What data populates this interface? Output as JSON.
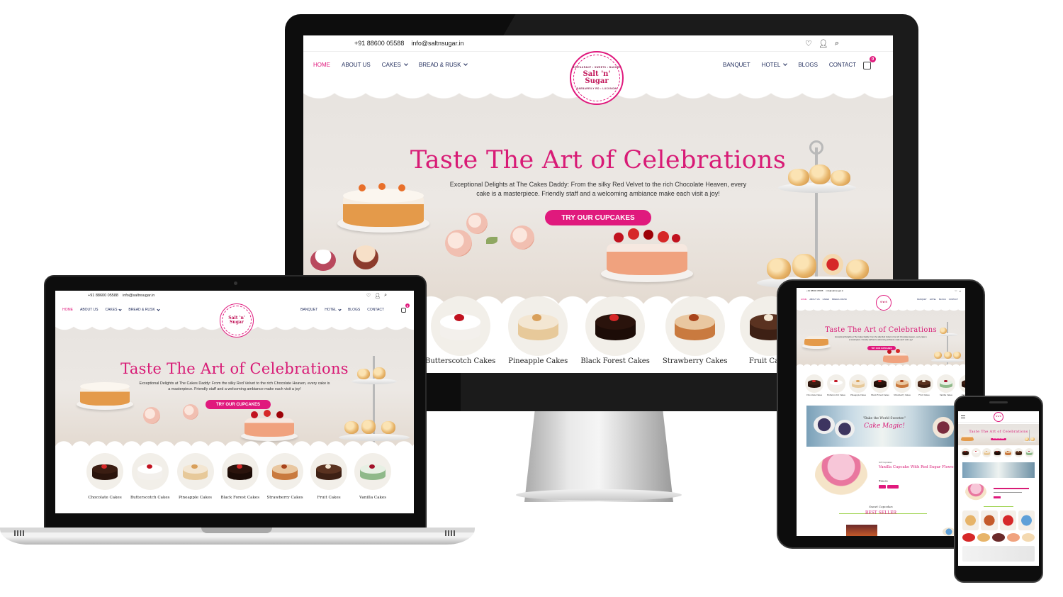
{
  "site": {
    "phone": "+91 88600 05588",
    "email": "info@saltnsugar.in",
    "nav_left": [
      {
        "label": "HOME",
        "active": true,
        "dropdown": false
      },
      {
        "label": "ABOUT US",
        "active": false,
        "dropdown": false
      },
      {
        "label": "CAKES",
        "active": false,
        "dropdown": true
      },
      {
        "label": "BREAD & RUSK",
        "active": false,
        "dropdown": true
      }
    ],
    "nav_right": [
      {
        "label": "BANQUET",
        "dropdown": false
      },
      {
        "label": "HOTEL",
        "dropdown": true
      },
      {
        "label": "BLOGS",
        "dropdown": false
      },
      {
        "label": "CONTACT",
        "dropdown": false
      }
    ],
    "cart_count": "0",
    "logo": {
      "mark": "Salt 'n' Sugar",
      "arc_top": "RESTAURANT • SWEETS • BAKERY",
      "arc_bottom": "RAEBAREILY RD • LUCKNOW"
    },
    "hero": {
      "title": "Taste The Art of Celebrations",
      "description": "Exceptional Delights at The Cakes Daddy: From the silky Red Velvet to the rich Chocolate Heaven, every cake is a masterpiece. Friendly staff and a welcoming ambiance make each visit a joy!",
      "cta": "TRY OUR CUPCAKES"
    },
    "categories": [
      "Chocolate Cakes",
      "Butterscotch Cakes",
      "Pineapple Cakes",
      "Black Forest Cakes",
      "Strawberry Cakes",
      "Fruit Cakes",
      "Vanilla Cakes"
    ],
    "monitor_categories": [
      "Butterscotch Cakes",
      "Pineapple Cakes",
      "Black Forest Cakes",
      "Strawberry Cakes",
      "Fruit Cakes"
    ],
    "banner": {
      "quote": "\"Bake the World Sweeter.\"",
      "script": "Cake Magic!"
    },
    "product": {
      "category": "Gift Cupcakes",
      "name": "Vanilla Cupcake With Red Sugar Flowers",
      "price": "₹59.00"
    },
    "section": {
      "kicker": "Sweet Cupcakes",
      "title": "BEST SELLER"
    }
  },
  "colors": {
    "brand_pink": "#e0197d",
    "nav_navy": "#1e2a5a",
    "hero_bg": "#ebe7e3"
  }
}
